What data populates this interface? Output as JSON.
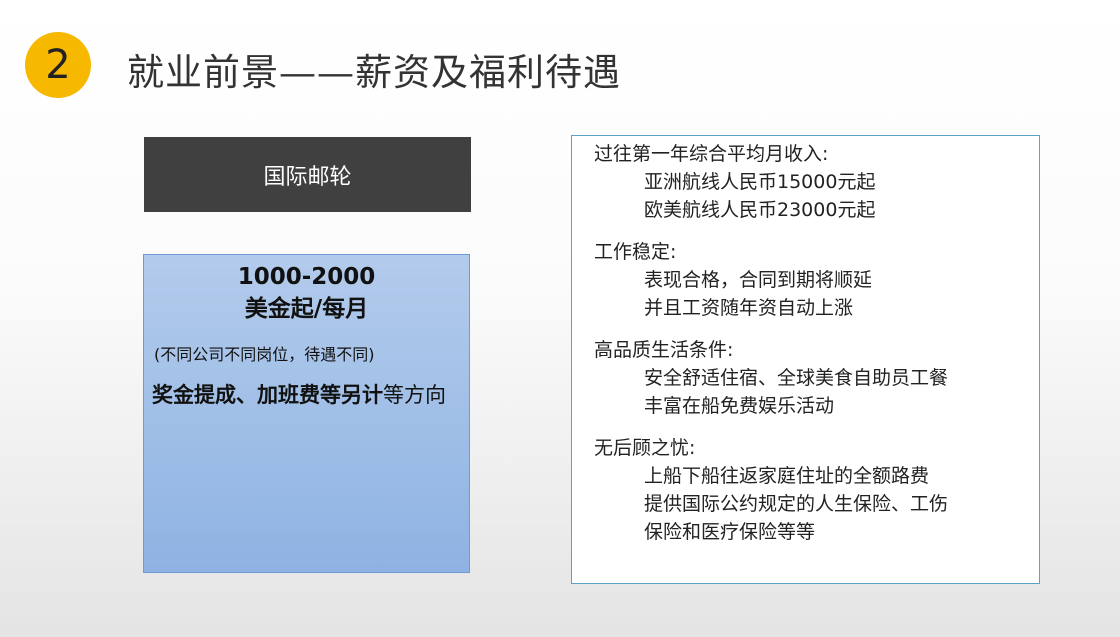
{
  "header": {
    "badge": "2",
    "title": "就业前景——薪资及福利待遇"
  },
  "left": {
    "category": "国际邮轮",
    "salary_line1": "1000-2000",
    "salary_line2": "美金起/每月",
    "note": "(不同公司不同岗位，待遇不同)",
    "bonus_bold": "奖金提成、加班费等另计",
    "bonus_rest": "等方向"
  },
  "right": {
    "sections": [
      {
        "heading": "过往第一年综合平均月收入:",
        "lines": [
          "亚洲航线人民币15000元起",
          "欧美航线人民币23000元起"
        ]
      },
      {
        "heading": "工作稳定:",
        "lines": [
          "表现合格，合同到期将顺延",
          "并且工资随年资自动上涨"
        ]
      },
      {
        "heading": "高品质生活条件:",
        "lines": [
          "安全舒适住宿、全球美食自助员工餐",
          "丰富在船免费娱乐活动"
        ]
      },
      {
        "heading": "无后顾之忧:",
        "lines": [
          "上船下船往返家庭住址的全额路费",
          "提供国际公约规定的人生保险、工伤",
          "保险和医疗保险等等"
        ]
      }
    ]
  }
}
